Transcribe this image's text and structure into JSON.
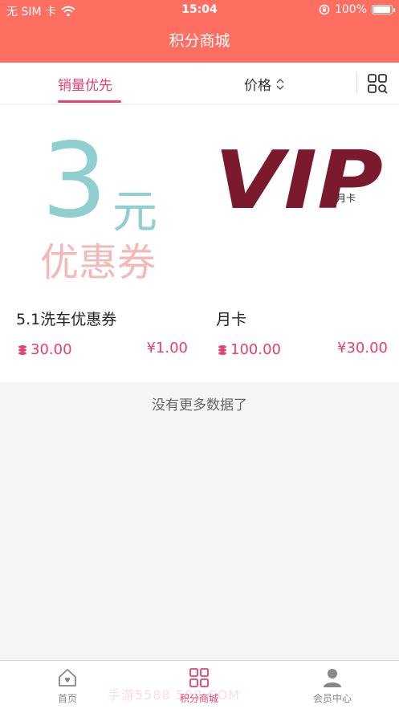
{
  "status_bar": {
    "carrier": "无 SIM 卡",
    "time": "15:04",
    "battery": "100%"
  },
  "header": {
    "title": "积分商城"
  },
  "tabs": {
    "sales_label": "销量优先",
    "price_label": "价格"
  },
  "products": [
    {
      "name": "5.1洗车优惠券",
      "points_price": "30.00",
      "cash_price": "¥1.00",
      "image": {
        "big_digit": "3",
        "unit": "元",
        "caption": "优惠券"
      }
    },
    {
      "name": "月卡",
      "points_price": "100.00",
      "cash_price": "¥30.00",
      "image": {
        "brand": "VIP",
        "subtitle": "月卡"
      }
    }
  ],
  "footer_message": "没有更多数据了",
  "bottom_nav": {
    "home_label": "首页",
    "mall_label": "积分商城",
    "member_label": "会员中心"
  },
  "watermark": "手游5588 588.COM",
  "colors": {
    "header": "#ff6f61",
    "accent": "#e6416f",
    "vip": "#7a1a2c",
    "coupon_teal": "#8fcfcf",
    "coupon_pink": "#f3b8b8"
  },
  "icons": {
    "wifi": "wifi-icon",
    "lock": "orientation-lock-icon",
    "sort": "sort-updown-icon",
    "grid_toggle": "grid-view-icon",
    "coin": "points-coin-icon",
    "home": "home-heart-icon",
    "mall": "grid-apps-icon",
    "member": "person-icon"
  }
}
